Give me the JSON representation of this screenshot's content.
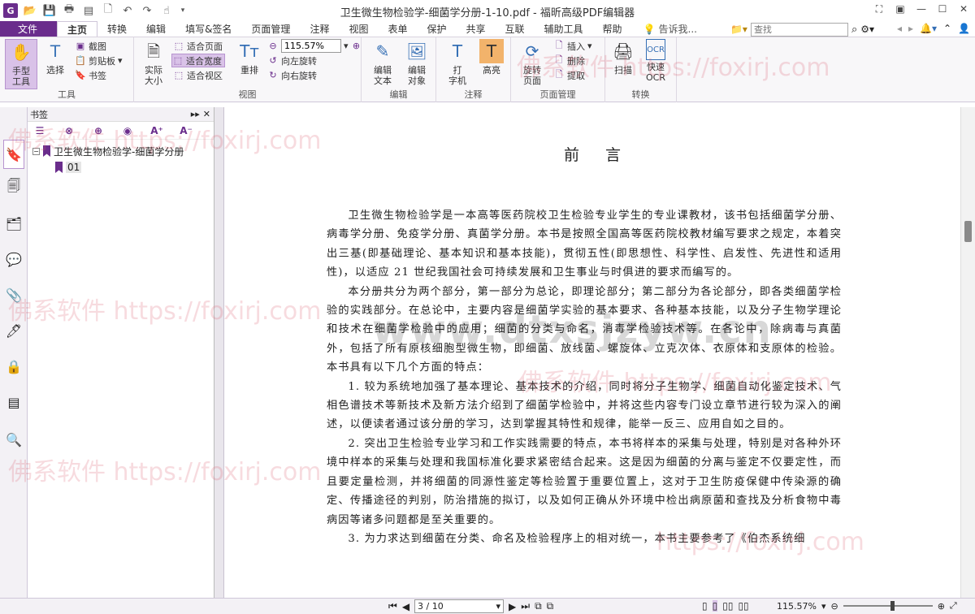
{
  "app": {
    "title": "卫生微生物检验学-细菌学分册-1-10.pdf - 福昕高级PDF编辑器",
    "logo": "G"
  },
  "tabs": [
    {
      "label": "文件"
    },
    {
      "label": "主页"
    },
    {
      "label": "转换"
    },
    {
      "label": "编辑"
    },
    {
      "label": "填写&签名"
    },
    {
      "label": "页面管理"
    },
    {
      "label": "注释"
    },
    {
      "label": "视图"
    },
    {
      "label": "表单"
    },
    {
      "label": "保护"
    },
    {
      "label": "共享"
    },
    {
      "label": "互联"
    },
    {
      "label": "辅助工具"
    },
    {
      "label": "帮助"
    }
  ],
  "tell_me": "告诉我...",
  "search": {
    "placeholder": "查找"
  },
  "ribbon": {
    "tools": {
      "group_label": "工具",
      "hand": "手型\n工具",
      "select": "选择",
      "screenshot": "截图",
      "clipboard": "剪贴板",
      "bookmark": "书签"
    },
    "view": {
      "group_label": "视图",
      "actual_size": "实际\n大小",
      "fit_page": "适合页面",
      "fit_width": "适合宽度",
      "fit_area": "适合视区",
      "reflow": "重排",
      "zoom_value": "115.57%",
      "rotate_left": "向左旋转",
      "rotate_right": "向右旋转"
    },
    "edit": {
      "group_label": "编辑",
      "edit_text": "编辑\n文本",
      "edit_object": "编辑\n对象"
    },
    "comment": {
      "group_label": "注释",
      "typewriter": "打\n字机",
      "highlight": "高亮"
    },
    "page_mgmt": {
      "group_label": "页面管理",
      "rotate_page": "旋转\n页面",
      "insert": "插入",
      "delete": "删除",
      "extract": "提取"
    },
    "convert": {
      "group_label": "转换",
      "scan": "扫描",
      "ocr": "快速\nOCR"
    }
  },
  "bookmarks": {
    "title": "书签",
    "root": "卫生微生物检验学-细菌学分册",
    "child": "01"
  },
  "document": {
    "heading": "前言",
    "paragraphs": [
      "卫生微生物检验学是一本高等医药院校卫生检验专业学生的专业课教材，该书包括细菌学分册、病毒学分册、免疫学分册、真菌学分册。本书是按照全国高等医药院校教材编写要求之规定，本着突出三基(即基础理论、基本知识和基本技能)，贯彻五性(即思想性、科学性、启发性、先进性和适用性)，以适应 21 世纪我国社会可持续发展和卫生事业与时俱进的要求而编写的。",
      "本分册共分为两个部分，第一部分为总论，即理论部分；第二部分为各论部分，即各类细菌学检验的实践部分。在总论中，主要内容是细菌学实验的基本要求、各种基本技能，以及分子生物学理论和技术在细菌学检验中的应用；细菌的分类与命名，消毒学检验技术等。在各论中，除病毒与真菌外，包括了所有原核细胞型微生物，即细菌、放线菌、螺旋体、立克次体、衣原体和支原体的检验。本书具有以下几个方面的特点：",
      "1. 较为系统地加强了基本理论、基本技术的介绍，同时将分子生物学、细菌自动化鉴定技术、气相色谱技术等新技术及新方法介绍到了细菌学检验中，并将这些内容专门设立章节进行较为深入的阐述，以便读者通过该分册的学习，达到掌握其特性和规律，能举一反三、应用自如之目的。",
      "2. 突出卫生检验专业学习和工作实践需要的特点，本书将样本的采集与处理，特别是对各种外环境中样本的采集与处理和我国标准化要求紧密结合起来。这是因为细菌的分离与鉴定不仅要定性，而且要定量检测，并将细菌的同源性鉴定等检验置于重要位置上，这对于卫生防疫保健中传染源的确定、传播途径的判别，防治措施的拟订，以及如何正确从外环境中检出病原菌和查找及分析食物中毒病因等诸多问题都是至关重要的。",
      "3. 为力求达到细菌在分类、命名及检验程序上的相对统一，本书主要参考了《伯杰系统细"
    ]
  },
  "watermarks": {
    "site": "佛系软件 https://foxirj.com",
    "site_short": "https://foxirj.com",
    "big": "www.dtxsjzyw.cn"
  },
  "status": {
    "page": "3 / 10",
    "zoom": "115.57%"
  },
  "colors": {
    "brand": "#6a2d8c",
    "selected_bg": "#d9c2e8"
  }
}
